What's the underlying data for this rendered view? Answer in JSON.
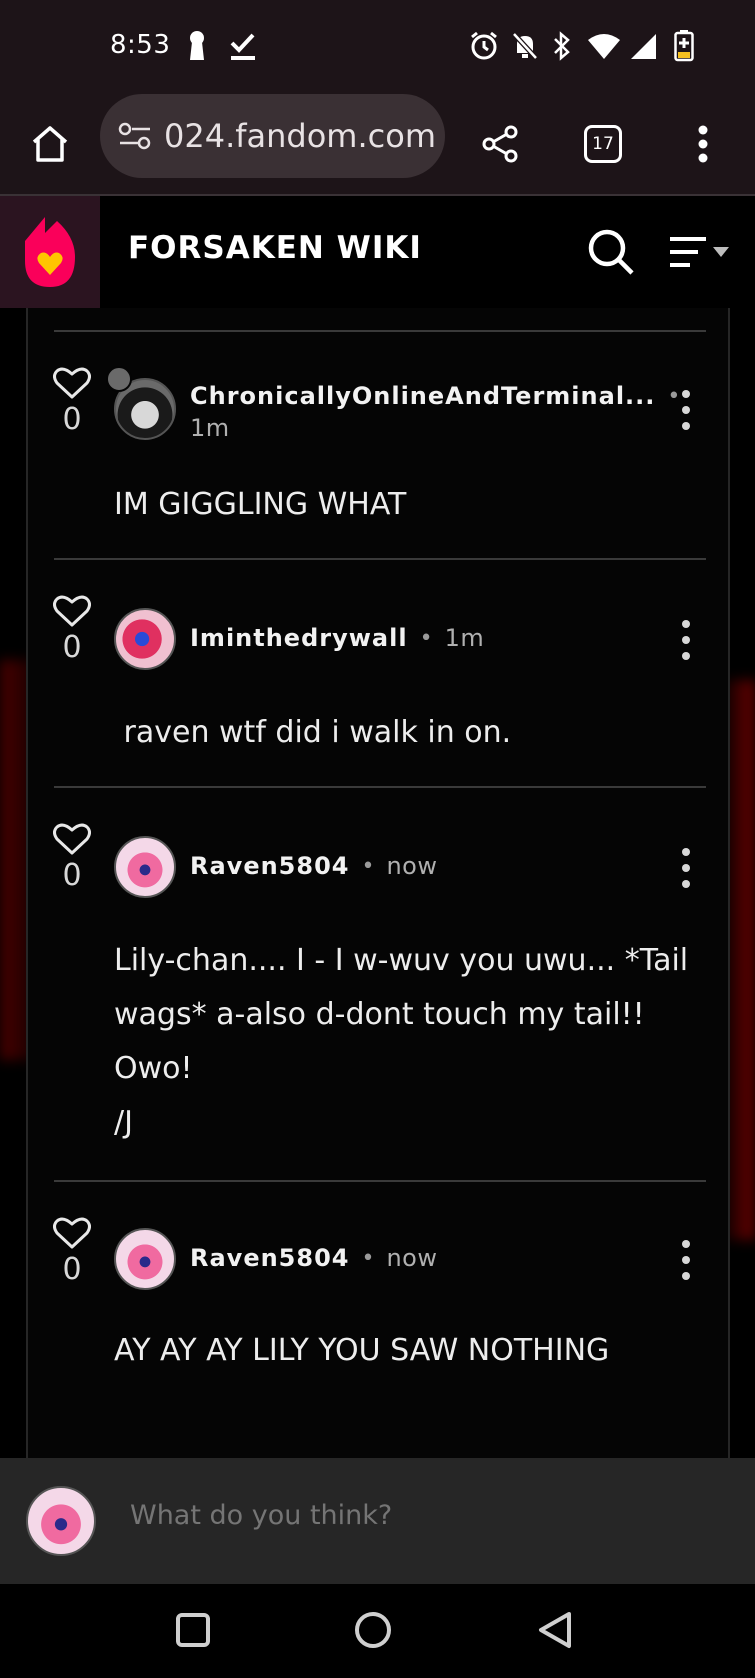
{
  "status_bar": {
    "time": "8:53",
    "icons": [
      "keyhole-icon",
      "check-icon",
      "alarm-icon",
      "mute-bell-icon",
      "bluetooth-icon",
      "wifi-icon",
      "signal-icon",
      "battery-charging-icon"
    ]
  },
  "browser": {
    "url": "024.fandom.com",
    "tab_count": "17"
  },
  "wiki": {
    "title": "FORSAKEN WIKI"
  },
  "comments": [
    {
      "username": "ChronicallyOnlineAndTerminal...",
      "time": "1m",
      "likes": "0",
      "body": "IM GIGGLING WHAT"
    },
    {
      "username": "Iminthedrywall",
      "time": "1m",
      "likes": "0",
      "body": " raven wtf did i walk in on."
    },
    {
      "username": "Raven5804",
      "time": "now",
      "likes": "0",
      "body_lines": [
        "Lily-chan.... I - I w-wuv you uwu... *Tail",
        "wags* a-also d-dont touch my tail!!",
        "Owo!",
        "/J"
      ]
    },
    {
      "username": "Raven5804",
      "time": "now",
      "likes": "0",
      "body": "AY AY AY LILY YOU SAW NOTHING"
    }
  ],
  "compose": {
    "placeholder": "What do you think?"
  },
  "colors": {
    "chrome_bg": "#1d1418",
    "panel_bg": "#050505",
    "fandom_pink": "#fa005a",
    "fandom_yellow": "#ffc500"
  }
}
